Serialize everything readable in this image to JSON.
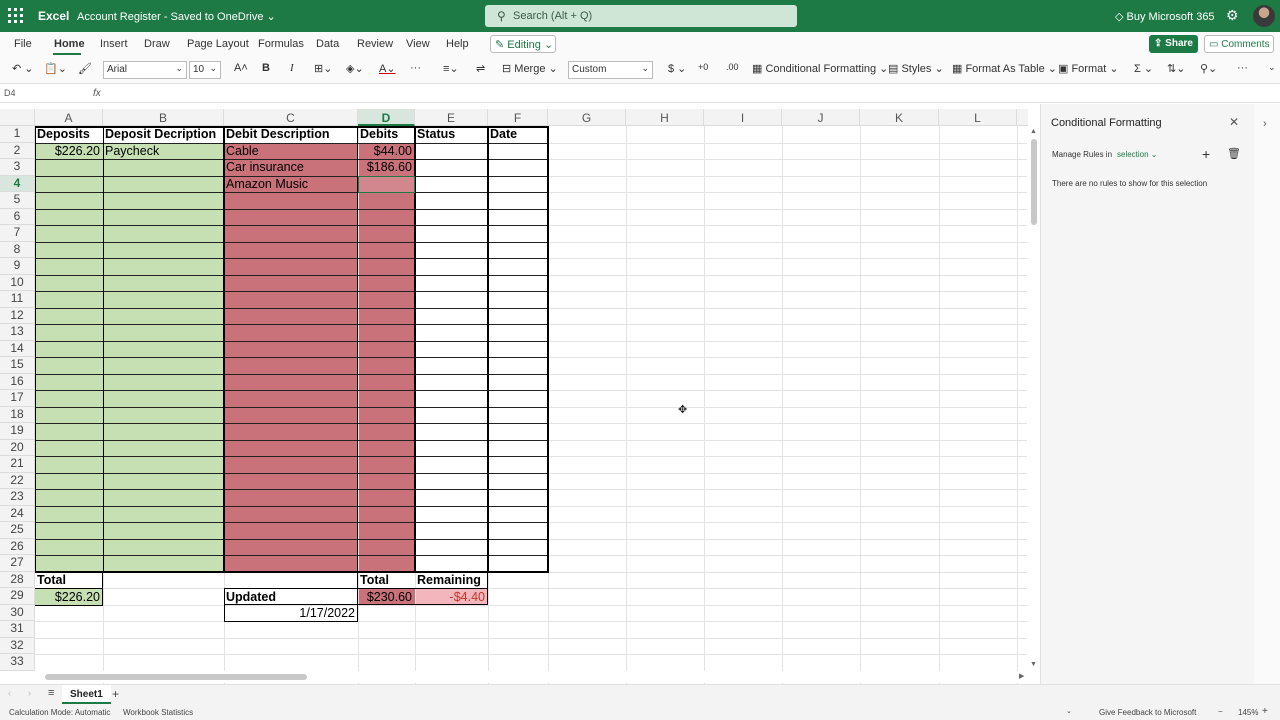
{
  "titlebar": {
    "app_name": "Excel",
    "doc_name": "Account Register - Saved to OneDrive ⌄",
    "search_placeholder": "Search (Alt + Q)",
    "buy_label": "Buy Microsoft 365"
  },
  "ribbon": {
    "tabs": [
      "File",
      "Home",
      "Insert",
      "Draw",
      "Page Layout",
      "Formulas",
      "Data",
      "Review",
      "View",
      "Help"
    ],
    "active_tab": "Home",
    "editing_label": "Editing",
    "share_label": "Share",
    "comments_label": "Comments"
  },
  "toolbar": {
    "font_name": "Arial",
    "font_size": "10",
    "merge_label": "Merge",
    "number_format": "Custom",
    "conditional_formatting": "Conditional Formatting",
    "styles": "Styles",
    "format_as_table": "Format As Table",
    "format": "Format"
  },
  "formula_bar": {
    "name_box": "D4",
    "fx": "fx",
    "content": ""
  },
  "grid": {
    "columns": [
      "A",
      "B",
      "C",
      "D",
      "E",
      "F",
      "G",
      "H",
      "I",
      "J",
      "K",
      "L"
    ],
    "selected_column": "D",
    "selected_row": "4",
    "rows": [
      "1",
      "2",
      "3",
      "4",
      "5",
      "6",
      "7",
      "8",
      "9",
      "10",
      "11",
      "12",
      "13",
      "14",
      "15",
      "16",
      "17",
      "18",
      "19",
      "20",
      "21",
      "22",
      "23",
      "24",
      "25",
      "26",
      "27",
      "28",
      "29",
      "30",
      "31",
      "32",
      "33"
    ],
    "headers": {
      "deposits": "Deposits",
      "deposit_description": "Deposit Decription",
      "debit_description": "Debit Description",
      "debits": "Debits",
      "status": "Status",
      "date": "Date"
    },
    "cells": {
      "a2": "$226.20",
      "b2": "Paycheck",
      "c2": "Cable",
      "d2": "$44.00",
      "c3": "Car insurance",
      "d3": "$186.60",
      "c4": "Amazon Music",
      "a28": "Total",
      "d28": "Total",
      "e28": "Remaining",
      "a29": "$226.20",
      "c29": "Updated",
      "d29": "$230.60",
      "e29": "-$4.40",
      "c30": "1/17/2022"
    },
    "colors": {
      "deposits_fill": "#c6e0b4",
      "debits_fill": "#c9727a",
      "remaining_fill": "#f4b6bd",
      "remaining_text": "#c0392b"
    }
  },
  "pane": {
    "title": "Conditional Formatting",
    "manage_label": "Manage Rules in",
    "manage_value": "selection ⌄",
    "empty_text": "There are no rules to show for this selection"
  },
  "sheets": {
    "tabs": [
      "Sheet1"
    ],
    "active": "Sheet1"
  },
  "status": {
    "calc_mode": "Calculation Mode: Automatic",
    "workbook_stats": "Workbook Statistics",
    "feedback": "Give Feedback to Microsoft",
    "zoom": "145%"
  }
}
